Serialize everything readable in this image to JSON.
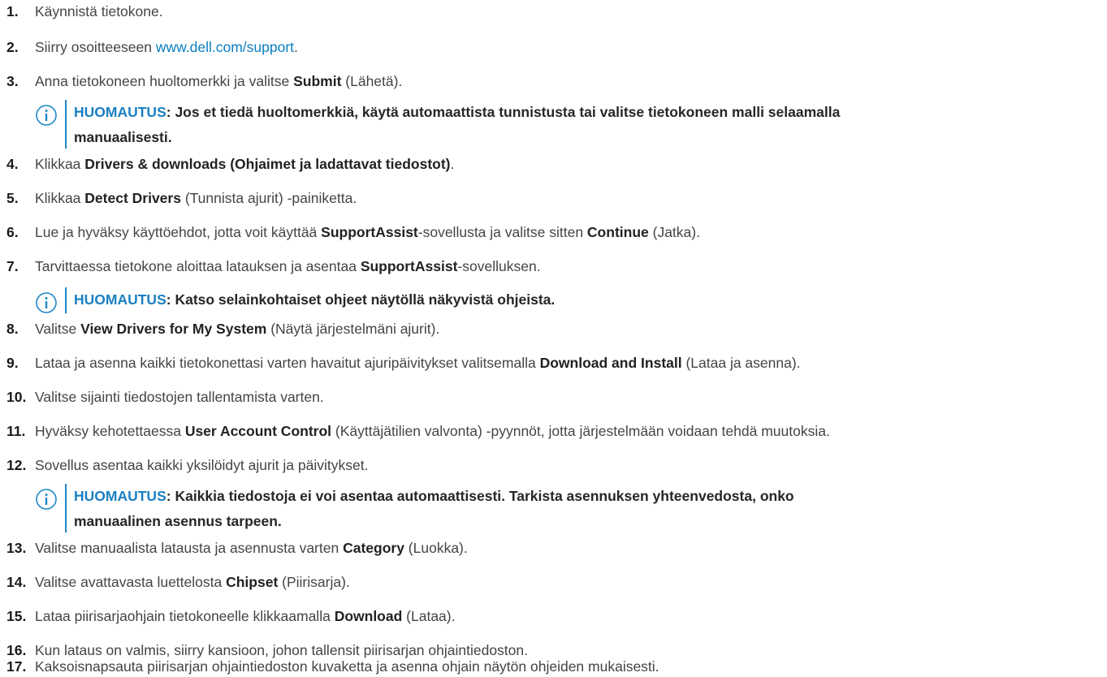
{
  "steps": [
    {
      "num": "1.",
      "parts": [
        {
          "t": "Käynnistä tietokone."
        }
      ]
    },
    {
      "num": "2.",
      "parts": [
        {
          "t": "Siirry osoitteeseen "
        },
        {
          "t": "www.dell.com/support",
          "link": true
        },
        {
          "t": "."
        }
      ]
    },
    {
      "num": "3.",
      "parts": [
        {
          "t": "Anna tietokoneen huoltomerkki ja valitse "
        },
        {
          "t": "Submit",
          "b": true
        },
        {
          "t": " (Lähetä)."
        }
      ]
    },
    {
      "num": "4.",
      "parts": [
        {
          "t": "Klikkaa "
        },
        {
          "t": "Drivers & downloads (Ohjaimet ja ladattavat tiedostot)",
          "b": true
        },
        {
          "t": "."
        }
      ]
    },
    {
      "num": "5.",
      "parts": [
        {
          "t": "Klikkaa "
        },
        {
          "t": "Detect Drivers",
          "b": true
        },
        {
          "t": " (Tunnista ajurit) -painiketta."
        }
      ]
    },
    {
      "num": "6.",
      "parts": [
        {
          "t": "Lue ja hyväksy käyttöehdot, jotta voit käyttää "
        },
        {
          "t": "SupportAssist",
          "b": true
        },
        {
          "t": "-sovellusta ja valitse sitten "
        },
        {
          "t": "Continue",
          "b": true
        },
        {
          "t": " (Jatka)."
        }
      ]
    },
    {
      "num": "7.",
      "parts": [
        {
          "t": "Tarvittaessa tietokone aloittaa latauksen ja asentaa "
        },
        {
          "t": "SupportAssist",
          "b": true
        },
        {
          "t": "-sovelluksen."
        }
      ]
    },
    {
      "num": "8.",
      "parts": [
        {
          "t": "Valitse "
        },
        {
          "t": "View Drivers for My System",
          "b": true
        },
        {
          "t": " (Näytä järjestelmäni ajurit)."
        }
      ]
    },
    {
      "num": "9.",
      "parts": [
        {
          "t": "Lataa ja asenna kaikki tietokonettasi varten havaitut ajuripäivitykset valitsemalla "
        },
        {
          "t": "Download and Install",
          "b": true
        },
        {
          "t": " (Lataa ja asenna)."
        }
      ]
    },
    {
      "num": "10.",
      "parts": [
        {
          "t": "Valitse sijainti tiedostojen tallentamista varten."
        }
      ]
    },
    {
      "num": "11.",
      "parts": [
        {
          "t": "Hyväksy kehotettaessa "
        },
        {
          "t": "User Account Control",
          "b": true
        },
        {
          "t": " (Käyttäjätilien valvonta) -pyynnöt, jotta järjestelmään voidaan tehdä muutoksia."
        }
      ]
    },
    {
      "num": "12.",
      "parts": [
        {
          "t": "Sovellus asentaa kaikki yksilöidyt ajurit ja päivitykset."
        }
      ]
    },
    {
      "num": "13.",
      "parts": [
        {
          "t": "Valitse manuaalista latausta ja asennusta varten "
        },
        {
          "t": "Category",
          "b": true
        },
        {
          "t": " (Luokka)."
        }
      ]
    },
    {
      "num": "14.",
      "parts": [
        {
          "t": "Valitse avattavasta luettelosta "
        },
        {
          "t": "Chipset",
          "b": true
        },
        {
          "t": " (Piirisarja)."
        }
      ]
    },
    {
      "num": "15.",
      "parts": [
        {
          "t": "Lataa piirisarjaohjain tietokoneelle klikkaamalla "
        },
        {
          "t": "Download",
          "b": true
        },
        {
          "t": " (Lataa)."
        }
      ]
    },
    {
      "num": "16.",
      "parts": [
        {
          "t": "Kun lataus on valmis, siirry kansioon, johon tallensit piirisarjan ohjaintiedoston."
        }
      ]
    },
    {
      "num": "17.",
      "parts": [
        {
          "t": "Kaksoisnapsauta piirisarjan ohjaintiedoston kuvaketta ja asenna ohjain näytön ohjeiden mukaisesti."
        }
      ]
    }
  ],
  "notes": [
    {
      "label": "HUOMAUTUS",
      "lines": [
        "Jos et tiedä huoltomerkkiä, käytä automaattista tunnistusta tai valitse tietokoneen malli selaamalla",
        "manuaalisesti."
      ]
    },
    {
      "label": "HUOMAUTUS",
      "lines": [
        "Katso selainkohtaiset ohjeet näytöllä näkyvistä ohjeista."
      ]
    },
    {
      "label": "HUOMAUTUS",
      "lines": [
        "Kaikkia tiedostoja ei voi asentaa automaattisesti. Tarkista asennuksen yhteenvedosta, onko",
        "manuaalinen asennus tarpeen."
      ]
    }
  ]
}
